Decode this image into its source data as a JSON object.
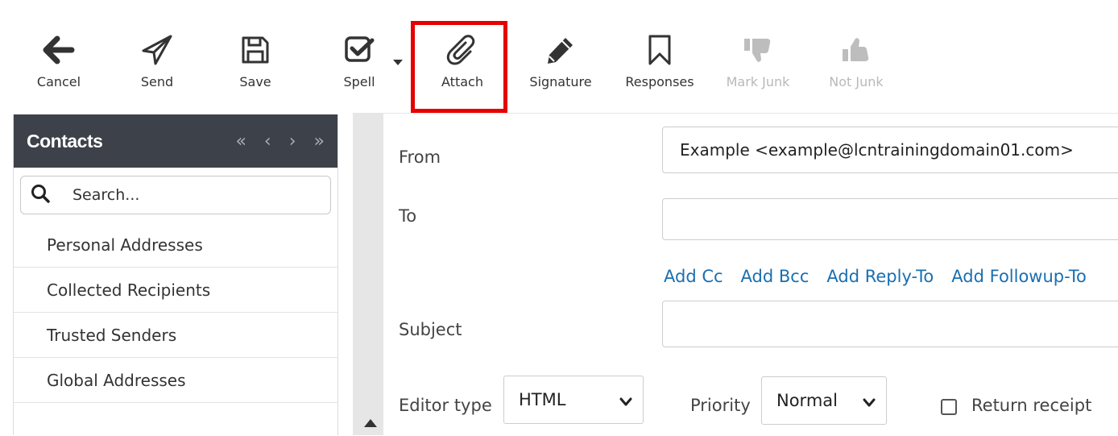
{
  "toolbar": {
    "buttons": [
      {
        "id": "cancel",
        "label": "Cancel",
        "icon": "arrow-left-icon",
        "enabled": true
      },
      {
        "id": "send",
        "label": "Send",
        "icon": "paper-plane-icon",
        "enabled": true
      },
      {
        "id": "save",
        "label": "Save",
        "icon": "floppy-disk-icon",
        "enabled": true
      },
      {
        "id": "spell",
        "label": "Spell",
        "icon": "check-square-icon",
        "enabled": true
      },
      {
        "id": "attach",
        "label": "Attach",
        "icon": "paperclip-icon",
        "enabled": true
      },
      {
        "id": "signature",
        "label": "Signature",
        "icon": "pencil-icon",
        "enabled": true
      },
      {
        "id": "responses",
        "label": "Responses",
        "icon": "bookmark-icon",
        "enabled": true
      },
      {
        "id": "mark_junk",
        "label": "Mark Junk",
        "icon": "thumbs-down-icon",
        "enabled": false
      },
      {
        "id": "not_junk",
        "label": "Not Junk",
        "icon": "thumbs-up-icon",
        "enabled": false
      }
    ],
    "highlight_color": "#e60000"
  },
  "contacts": {
    "title": "Contacts",
    "pager": [
      "«",
      "‹",
      "›",
      "»"
    ],
    "search_placeholder": "Search...",
    "items": [
      "Personal Addresses",
      "Collected Recipients",
      "Trusted Senders",
      "Global Addresses"
    ]
  },
  "compose": {
    "from_label": "From",
    "from_value": "Example <example@lcntrainingdomain01.com>",
    "to_label": "To",
    "to_value": "",
    "links": [
      "Add Cc",
      "Add Bcc",
      "Add Reply-To",
      "Add Followup-To"
    ],
    "subject_label": "Subject",
    "subject_value": "",
    "editor_type_label": "Editor type",
    "editor_type_value": "HTML",
    "priority_label": "Priority",
    "priority_value": "Normal",
    "return_receipt_label": "Return receipt",
    "return_receipt_checked": false
  },
  "colors": {
    "header_bg": "#3d4149",
    "link": "#1a6fb0",
    "disabled": "#b9b9b9"
  }
}
